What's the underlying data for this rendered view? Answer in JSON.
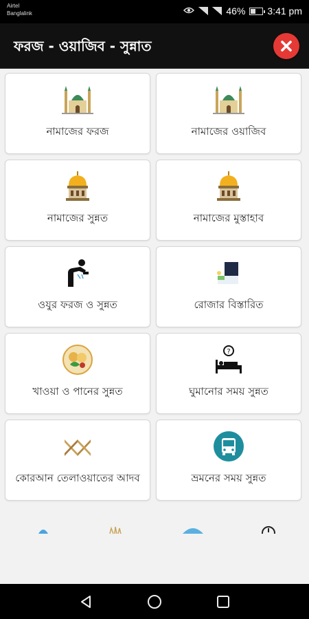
{
  "status_bar": {
    "carrier_1": "Airtel",
    "carrier_2": "Banglalink",
    "battery_text": "46%",
    "battery_level": 0.46,
    "time": "3:41 pm"
  },
  "app_bar": {
    "title": "ফরজ - ওয়াজিব - সুন্নাত",
    "close_color": "#e53935"
  },
  "tiles": [
    {
      "label": "নামাজের ফরজ",
      "icon": "mosque-icon"
    },
    {
      "label": "নামাজের ওয়াজিব",
      "icon": "mosque-icon"
    },
    {
      "label": "নামাজের সুন্নত",
      "icon": "golden-dome-icon"
    },
    {
      "label": "নামাজের মুস্তাহাব",
      "icon": "golden-dome-icon"
    },
    {
      "label": "ওযুর ফরজ ও সুন্নত",
      "icon": "ablution-icon"
    },
    {
      "label": "রোজার বিস্তারিত",
      "icon": "night-moon-icon"
    },
    {
      "label": "খাওয়া ও পানের সুন্নত",
      "icon": "food-plate-icon"
    },
    {
      "label": "ঘুমানোর সময় সুন্নত",
      "icon": "sleep-bed-icon"
    },
    {
      "label": "কোরআন তেলাওয়াতের আদব",
      "icon": "quran-stand-icon"
    },
    {
      "label": "ভ্রমনের সময় সুন্নত",
      "icon": "bus-icon"
    }
  ]
}
